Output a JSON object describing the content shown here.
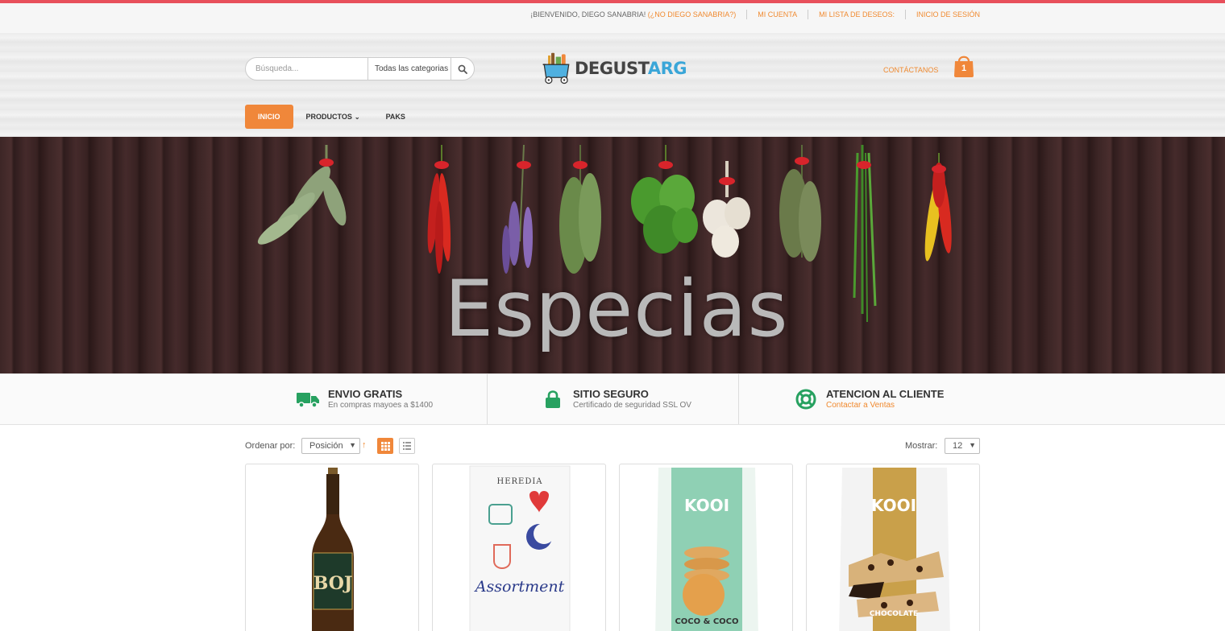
{
  "topbar": {
    "welcome": "¡BIENVENIDO, DIEGO SANABRIA!",
    "not_user": "(¿NO DIEGO SANABRIA?)",
    "links": [
      "MI CUENTA",
      "MI LISTA DE DESEOS:",
      "INICIO DE SESIÓN"
    ]
  },
  "search": {
    "placeholder": "Búsqueda...",
    "category": "Todas las categorias",
    "icon": "search-icon"
  },
  "logo": {
    "part1": "DEGUST",
    "part2": "ARG"
  },
  "header": {
    "contact": "CONTÁCTANOS",
    "cart_count": "1",
    "cart_icon": "shopping-bag-icon"
  },
  "nav": {
    "items": [
      "INICIO",
      "PRODUCTOS",
      "PAKS"
    ]
  },
  "banner": {
    "title": "Especias"
  },
  "features": [
    {
      "title": "ENVIO GRATIS",
      "subtitle": "En compras mayoes a $1400",
      "icon": "truck-icon"
    },
    {
      "title": "SITIO SEGURO",
      "subtitle": "Certificado de seguridad SSL OV",
      "icon": "lock-icon"
    },
    {
      "title": "ATENCION AL CLIENTE",
      "subtitle": "Contactar a Ventas",
      "icon": "lifebuoy-icon"
    }
  ],
  "toolbar": {
    "sort_label": "Ordenar por:",
    "sort_value": "Posición",
    "show_label": "Mostrar:",
    "show_value": "12"
  },
  "products": [
    {
      "image_text": "BOJ"
    },
    {
      "image_text": "HEREDIA",
      "image_sub": "Assortment"
    },
    {
      "image_text": "KOOI",
      "image_sub": "COCO & COCO"
    },
    {
      "image_text": "KOOI",
      "image_sub": "CHOCOLATE"
    }
  ],
  "colors": {
    "accent": "#f08a30",
    "topline": "#e8505b",
    "feature_green": "#27a160"
  }
}
